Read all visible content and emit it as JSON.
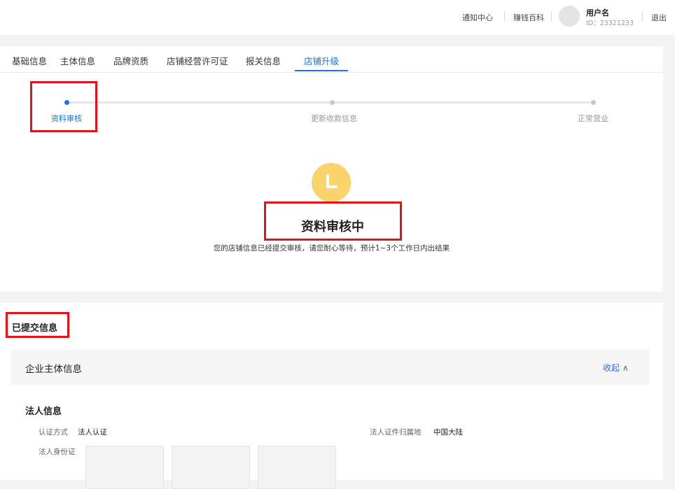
{
  "topbar": {
    "notifications": "通知中心",
    "wiki": "赚钱百科",
    "user_name": "用户名",
    "user_id": "ID：23321233",
    "logout": "退出"
  },
  "tabs": [
    {
      "label": "基础信息"
    },
    {
      "label": "主体信息"
    },
    {
      "label": "品牌资质"
    },
    {
      "label": "店铺经营许可证"
    },
    {
      "label": "报关信息"
    },
    {
      "label": "店铺升级",
      "active": true
    }
  ],
  "steps": [
    {
      "label": "资料审核",
      "state": "active"
    },
    {
      "label": "更新收款信息",
      "state": "pending"
    },
    {
      "label": "正常营业",
      "state": "pending"
    }
  ],
  "status": {
    "icon": "clock-icon",
    "title": "资料审核中",
    "subtitle": "您的店铺信息已经提交审核，请您耐心等待，预计1~3个工作日内出结果"
  },
  "submitted": {
    "title": "已提交信息",
    "section_title": "企业主体信息",
    "collapse_label": "收起 ∧",
    "legal_title": "法人信息",
    "fields": {
      "auth_method_label": "认证方式",
      "auth_method_value": "法人认证",
      "id_region_label": "法人证件归属地",
      "id_region_value": "中国大陆",
      "id_card_label": "法人身份证"
    }
  },
  "colors": {
    "accent": "#1a73e8",
    "highlight_box": "#e0151b",
    "status_icon": "#fad46b",
    "inactive_dot": "#c8c8c8"
  }
}
